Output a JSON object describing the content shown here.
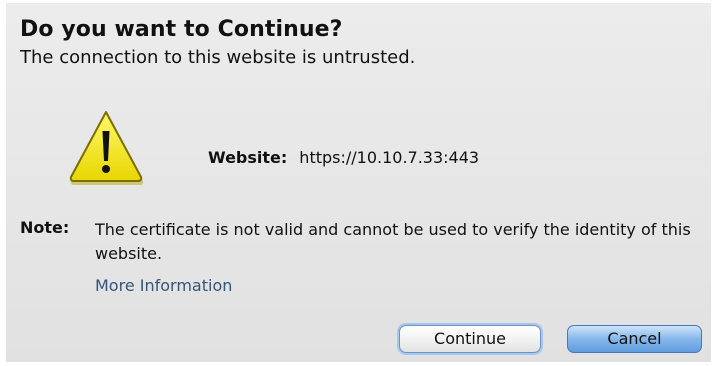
{
  "dialog": {
    "title": "Do you want to Continue?",
    "subtitle": "The connection to this website is untrusted.",
    "icon": "warning-triangle-icon",
    "website_label": "Website:",
    "website_url": "https://10.10.7.33:443",
    "note_label": "Note:",
    "note_text": "The certificate is not valid and cannot be used to verify the identity of this website.",
    "more_info_link": "More Information",
    "buttons": {
      "continue_label": "Continue",
      "cancel_label": "Cancel"
    }
  },
  "colors": {
    "link": "#335577",
    "default_button": "#5f9de0",
    "warning_icon": "#f4e400"
  }
}
